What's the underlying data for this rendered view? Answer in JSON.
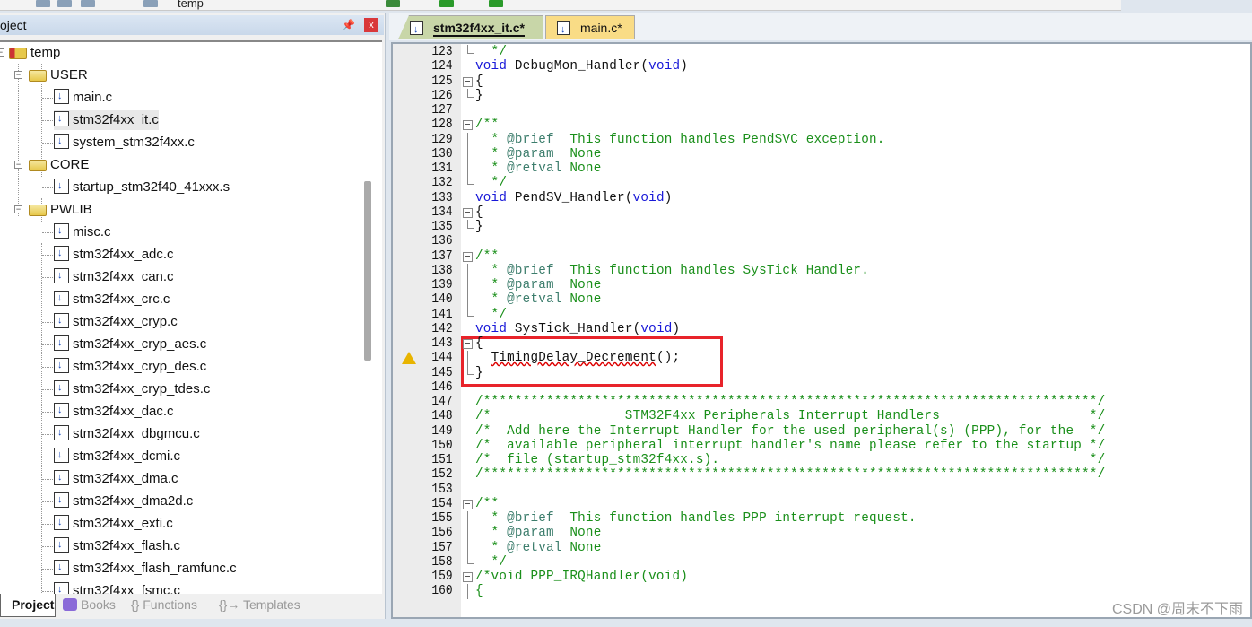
{
  "toolbar": {
    "target": "temp"
  },
  "project_panel": {
    "title": "oject",
    "pin_icon": "pin-icon",
    "close_label": "x"
  },
  "tree": [
    {
      "label": "temp",
      "type": "root",
      "level": 0
    },
    {
      "label": "USER",
      "type": "folder",
      "level": 1
    },
    {
      "label": "main.c",
      "type": "file",
      "level": 2
    },
    {
      "label": "stm32f4xx_it.c",
      "type": "file",
      "level": 2,
      "selected": true
    },
    {
      "label": "system_stm32f4xx.c",
      "type": "file",
      "level": 2
    },
    {
      "label": "CORE",
      "type": "folder",
      "level": 1
    },
    {
      "label": "startup_stm32f40_41xxx.s",
      "type": "file",
      "level": 2
    },
    {
      "label": "PWLIB",
      "type": "folder",
      "level": 1
    },
    {
      "label": "misc.c",
      "type": "file",
      "level": 2
    },
    {
      "label": "stm32f4xx_adc.c",
      "type": "file",
      "level": 2
    },
    {
      "label": "stm32f4xx_can.c",
      "type": "file",
      "level": 2
    },
    {
      "label": "stm32f4xx_crc.c",
      "type": "file",
      "level": 2
    },
    {
      "label": "stm32f4xx_cryp.c",
      "type": "file",
      "level": 2
    },
    {
      "label": "stm32f4xx_cryp_aes.c",
      "type": "file",
      "level": 2
    },
    {
      "label": "stm32f4xx_cryp_des.c",
      "type": "file",
      "level": 2
    },
    {
      "label": "stm32f4xx_cryp_tdes.c",
      "type": "file",
      "level": 2
    },
    {
      "label": "stm32f4xx_dac.c",
      "type": "file",
      "level": 2
    },
    {
      "label": "stm32f4xx_dbgmcu.c",
      "type": "file",
      "level": 2
    },
    {
      "label": "stm32f4xx_dcmi.c",
      "type": "file",
      "level": 2
    },
    {
      "label": "stm32f4xx_dma.c",
      "type": "file",
      "level": 2
    },
    {
      "label": "stm32f4xx_dma2d.c",
      "type": "file",
      "level": 2
    },
    {
      "label": "stm32f4xx_exti.c",
      "type": "file",
      "level": 2
    },
    {
      "label": "stm32f4xx_flash.c",
      "type": "file",
      "level": 2
    },
    {
      "label": "stm32f4xx_flash_ramfunc.c",
      "type": "file",
      "level": 2
    },
    {
      "label": "stm32f4xx_fsmc.c",
      "type": "file",
      "level": 2
    }
  ],
  "bottom_tabs": [
    {
      "label": "Project",
      "icon": "project-icon",
      "active": true
    },
    {
      "label": "Books",
      "icon": "books-icon"
    },
    {
      "label": "{} Functions",
      "icon": "functions-icon"
    },
    {
      "label": "{}→ Templates",
      "icon": "templates-icon"
    }
  ],
  "editor_tabs": [
    {
      "label": "stm32f4xx_it.c*",
      "active": true
    },
    {
      "label": "main.c*"
    }
  ],
  "colors": {
    "keyword": "#1818d8",
    "comment": "#1a8f1a",
    "highlight_box": "#e8232a",
    "active_tab": "#c8d6a8",
    "inactive_tab": "#f9dc86"
  },
  "code": [
    {
      "n": "123",
      "f": "end",
      "p": [
        [
          "cm",
          "  */"
        ]
      ]
    },
    {
      "n": "124",
      "f": "",
      "p": [
        [
          "kw",
          "void"
        ],
        [
          "",
          "DebugMon_Handler("
        ],
        [
          "kw",
          "void"
        ],
        [
          "",
          ")"
        ]
      ]
    },
    {
      "n": "125",
      "f": "open",
      "p": [
        [
          "",
          "{"
        ]
      ]
    },
    {
      "n": "126",
      "f": "end",
      "p": [
        [
          "",
          "}"
        ]
      ]
    },
    {
      "n": "127",
      "f": "",
      "p": []
    },
    {
      "n": "128",
      "f": "open",
      "p": [
        [
          "cm",
          "/**"
        ]
      ]
    },
    {
      "n": "129",
      "f": "line",
      "p": [
        [
          "cm",
          "  * "
        ],
        [
          "tg",
          "@brief"
        ],
        [
          "cm",
          "  This function handles PendSVC exception."
        ]
      ]
    },
    {
      "n": "130",
      "f": "line",
      "p": [
        [
          "cm",
          "  * "
        ],
        [
          "tg",
          "@param"
        ],
        [
          "cm",
          "  None"
        ]
      ]
    },
    {
      "n": "131",
      "f": "line",
      "p": [
        [
          "cm",
          "  * "
        ],
        [
          "tg",
          "@retval"
        ],
        [
          "cm",
          " None"
        ]
      ]
    },
    {
      "n": "132",
      "f": "end",
      "p": [
        [
          "cm",
          "  */"
        ]
      ]
    },
    {
      "n": "133",
      "f": "",
      "p": [
        [
          "kw",
          "void"
        ],
        [
          "",
          "PendSV_Handler("
        ],
        [
          "kw",
          "void"
        ],
        [
          "",
          ")"
        ]
      ]
    },
    {
      "n": "134",
      "f": "open",
      "p": [
        [
          "",
          "{"
        ]
      ]
    },
    {
      "n": "135",
      "f": "end",
      "p": [
        [
          "",
          "}"
        ]
      ]
    },
    {
      "n": "136",
      "f": "",
      "p": []
    },
    {
      "n": "137",
      "f": "open",
      "p": [
        [
          "cm",
          "/**"
        ]
      ]
    },
    {
      "n": "138",
      "f": "line",
      "p": [
        [
          "cm",
          "  * "
        ],
        [
          "tg",
          "@brief"
        ],
        [
          "cm",
          "  This function handles SysTick Handler."
        ]
      ]
    },
    {
      "n": "139",
      "f": "line",
      "p": [
        [
          "cm",
          "  * "
        ],
        [
          "tg",
          "@param"
        ],
        [
          "cm",
          "  None"
        ]
      ]
    },
    {
      "n": "140",
      "f": "line",
      "p": [
        [
          "cm",
          "  * "
        ],
        [
          "tg",
          "@retval"
        ],
        [
          "cm",
          " None"
        ]
      ]
    },
    {
      "n": "141",
      "f": "end",
      "p": [
        [
          "cm",
          "  */"
        ]
      ]
    },
    {
      "n": "142",
      "f": "",
      "p": [
        [
          "kw",
          "void"
        ],
        [
          "",
          "SysTick_Handler("
        ],
        [
          "kw",
          "void"
        ],
        [
          "",
          ")"
        ]
      ]
    },
    {
      "n": "143",
      "f": "open",
      "p": [
        [
          "",
          "{"
        ]
      ]
    },
    {
      "n": "144",
      "f": "line",
      "warn": true,
      "p": [
        [
          "",
          "  "
        ],
        [
          "sq",
          "TimingDelay_Decrement"
        ],
        [
          "",
          "();"
        ]
      ]
    },
    {
      "n": "145",
      "f": "end",
      "p": [
        [
          "",
          "}"
        ]
      ]
    },
    {
      "n": "146",
      "f": "",
      "p": []
    },
    {
      "n": "147",
      "f": "",
      "p": [
        [
          "cm",
          "/******************************************************************************/"
        ]
      ]
    },
    {
      "n": "148",
      "f": "",
      "p": [
        [
          "cm",
          "/*                 STM32F4xx Peripherals Interrupt Handlers                   */"
        ]
      ]
    },
    {
      "n": "149",
      "f": "",
      "p": [
        [
          "cm",
          "/*  Add here the Interrupt Handler for the used peripheral(s) (PPP), for the  */"
        ]
      ]
    },
    {
      "n": "150",
      "f": "",
      "p": [
        [
          "cm",
          "/*  available peripheral interrupt handler's name please refer to the startup */"
        ]
      ]
    },
    {
      "n": "151",
      "f": "",
      "p": [
        [
          "cm",
          "/*  file (startup_stm32f4xx.s).                                               */"
        ]
      ]
    },
    {
      "n": "152",
      "f": "",
      "p": [
        [
          "cm",
          "/******************************************************************************/"
        ]
      ]
    },
    {
      "n": "153",
      "f": "",
      "p": []
    },
    {
      "n": "154",
      "f": "open",
      "p": [
        [
          "cm",
          "/**"
        ]
      ]
    },
    {
      "n": "155",
      "f": "line",
      "p": [
        [
          "cm",
          "  * "
        ],
        [
          "tg",
          "@brief"
        ],
        [
          "cm",
          "  This function handles PPP interrupt request."
        ]
      ]
    },
    {
      "n": "156",
      "f": "line",
      "p": [
        [
          "cm",
          "  * "
        ],
        [
          "tg",
          "@param"
        ],
        [
          "cm",
          "  None"
        ]
      ]
    },
    {
      "n": "157",
      "f": "line",
      "p": [
        [
          "cm",
          "  * "
        ],
        [
          "tg",
          "@retval"
        ],
        [
          "cm",
          " None"
        ]
      ]
    },
    {
      "n": "158",
      "f": "end",
      "p": [
        [
          "cm",
          "  */"
        ]
      ]
    },
    {
      "n": "159",
      "f": "open",
      "p": [
        [
          "cm",
          "/*void PPP_IRQHandler(void)"
        ]
      ]
    },
    {
      "n": "160",
      "f": "line",
      "p": [
        [
          "cm",
          "{"
        ]
      ]
    }
  ],
  "watermark": "CSDN @周末不下雨"
}
